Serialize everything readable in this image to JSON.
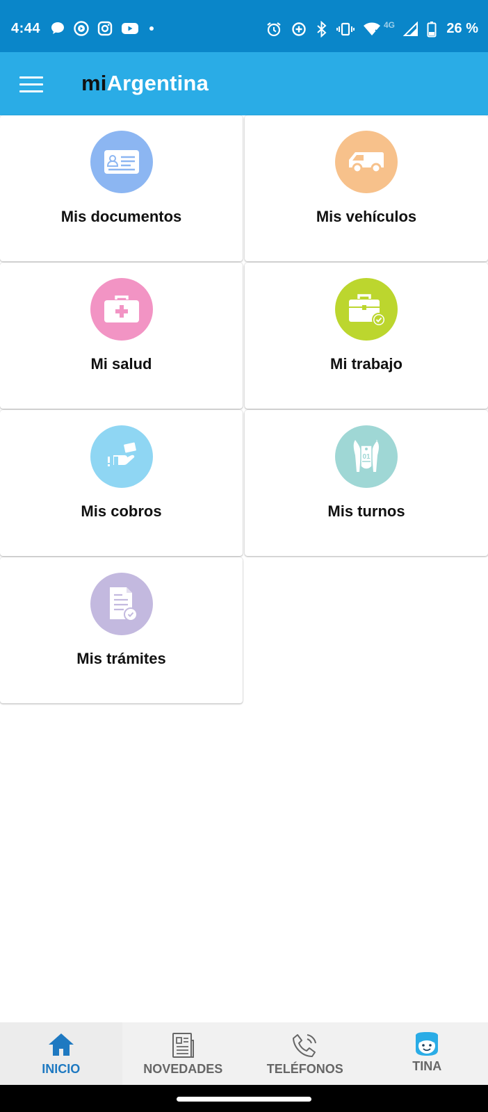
{
  "status_bar": {
    "time": "4:44",
    "network_label": "4G",
    "battery": "26 %",
    "left_icons": [
      "messages-icon",
      "play-icon",
      "instagram-icon",
      "youtube-icon",
      "dot-icon"
    ],
    "right_icons": [
      "alarm-icon",
      "data-saver-icon",
      "bluetooth-icon",
      "vibrate-icon",
      "wifi-icon",
      "signal-icon",
      "battery-icon"
    ]
  },
  "app_bar": {
    "title_part1": "mi",
    "title_part2": "Argentina"
  },
  "cards": [
    {
      "label": "Mis documentos",
      "icon": "id-card-icon",
      "color": "#8cb6f2"
    },
    {
      "label": "Mis vehículos",
      "icon": "van-icon",
      "color": "#f7c18b"
    },
    {
      "label": "Mi salud",
      "icon": "medical-kit-icon",
      "color": "#f294c4"
    },
    {
      "label": "Mi trabajo",
      "icon": "briefcase-check-icon",
      "color": "#bcd62e"
    },
    {
      "label": "Mis cobros",
      "icon": "hand-money-icon",
      "color": "#8fd6f3"
    },
    {
      "label": "Mis turnos",
      "icon": "ticket-icon",
      "color": "#9fd7d5"
    },
    {
      "label": "Mis trámites",
      "icon": "document-check-icon",
      "color": "#c3b9df"
    }
  ],
  "bottom_nav": {
    "items": [
      {
        "label": "INICIO",
        "icon": "home-icon",
        "active": true
      },
      {
        "label": "NOVEDADES",
        "icon": "newspaper-icon",
        "active": false
      },
      {
        "label": "TELÉFONOS",
        "icon": "phone-icon",
        "active": false
      },
      {
        "label": "TINA",
        "icon": "tina-bot-icon",
        "active": false
      }
    ]
  },
  "colors": {
    "status_bar": "#0a86c9",
    "app_bar": "#2aace6",
    "active_nav": "#1e79c1"
  }
}
